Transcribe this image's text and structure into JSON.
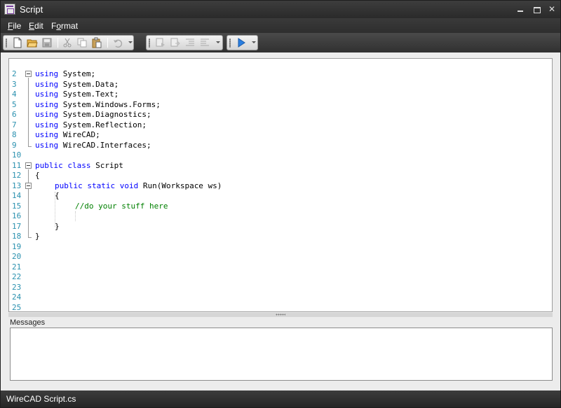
{
  "window": {
    "title": "Script"
  },
  "menu": {
    "file": {
      "label": "File",
      "accel": "F",
      "rest": "ile"
    },
    "edit": {
      "label": "Edit",
      "accel": "E",
      "rest": "dit"
    },
    "format": {
      "label": "Format",
      "accel": "o",
      "pre": "F",
      "rest": "rmat"
    }
  },
  "toolbar": {
    "groups": [
      {
        "name": "file-edit",
        "buttons": [
          "new-document-icon",
          "open-folder-icon",
          "save-icon",
          "cut-icon",
          "copy-icon",
          "paste-icon",
          "undo-icon"
        ]
      },
      {
        "name": "bookmarks-indent",
        "buttons": [
          "toggle-bookmark-icon",
          "next-bookmark-icon",
          "indent-icon",
          "outdent-icon"
        ]
      },
      {
        "name": "run",
        "buttons": [
          "run-play-icon"
        ]
      }
    ]
  },
  "editor": {
    "line_numbers": [
      "2",
      "3",
      "4",
      "5",
      "6",
      "7",
      "8",
      "9",
      "10",
      "11",
      "12",
      "13",
      "14",
      "15",
      "16",
      "17",
      "18",
      "19",
      "20",
      "21",
      "22",
      "23",
      "24",
      "25"
    ],
    "lines": [
      {
        "kw": "using",
        "text": " System;"
      },
      {
        "kw": "using",
        "text": " System.Data;"
      },
      {
        "kw": "using",
        "text": " System.Text;"
      },
      {
        "kw": "using",
        "text": " System.Windows.Forms;"
      },
      {
        "kw": "using",
        "text": " System.Diagnostics;"
      },
      {
        "kw": "using",
        "text": " System.Reflection;"
      },
      {
        "kw": "using",
        "text": " WireCAD;"
      },
      {
        "kw": "using",
        "text": " WireCAD.Interfaces;"
      },
      {
        "kw": "",
        "text": ""
      },
      {
        "kw": "public class",
        "text": " Script"
      },
      {
        "kw": "",
        "text": "{"
      },
      {
        "kw": "public static void",
        "text": " Run(Workspace ws)"
      },
      {
        "kw": "",
        "text": "{"
      },
      {
        "comment": "//do your stuff here"
      },
      {
        "kw": "",
        "text": ""
      },
      {
        "kw": "",
        "text": "}"
      },
      {
        "kw": "",
        "text": "}"
      }
    ]
  },
  "messages": {
    "label": "Messages"
  },
  "status": {
    "text": "WireCAD Script.cs"
  },
  "colors": {
    "keyword": "#0000ff",
    "comment": "#008000",
    "line_number": "#2b91af",
    "chrome": "#2e2e2e"
  }
}
